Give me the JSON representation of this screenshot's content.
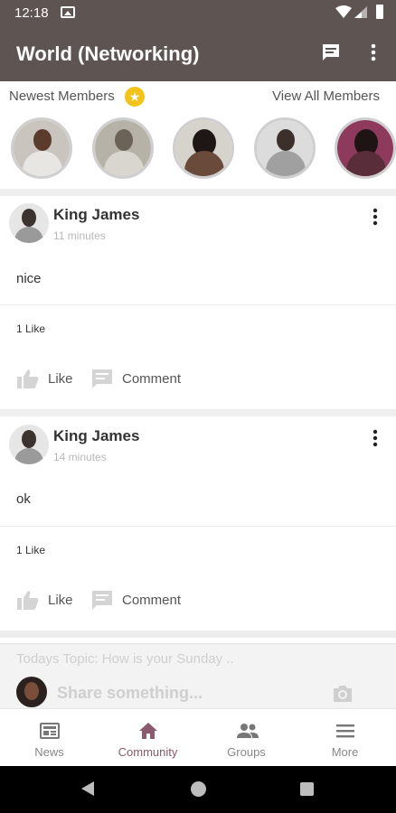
{
  "status_bar": {
    "time": "12:18"
  },
  "app_bar": {
    "title": "World (Networking)"
  },
  "members": {
    "heading": "Newest Members",
    "view_all": "View All Members",
    "count_shown": 5
  },
  "posts": [
    {
      "author": "King James",
      "time": "11 minutes",
      "text": "nice",
      "likes": "1 Like",
      "like_label": "Like",
      "comment_label": "Comment"
    },
    {
      "author": "King James",
      "time": "14 minutes",
      "text": "ok",
      "likes": "1 Like",
      "like_label": "Like",
      "comment_label": "Comment"
    }
  ],
  "composer": {
    "topic": "Todays Topic: How is your Sunday ..",
    "placeholder": "Share something..."
  },
  "bottom_nav": [
    {
      "label": "News",
      "icon": "newspaper-icon"
    },
    {
      "label": "Community",
      "icon": "home-icon",
      "active": true
    },
    {
      "label": "Groups",
      "icon": "people-icon"
    },
    {
      "label": "More",
      "icon": "menu-icon"
    }
  ],
  "colors": {
    "app_bar": "#5e5452",
    "accent": "#8a5a6e",
    "star": "#f2c318"
  }
}
